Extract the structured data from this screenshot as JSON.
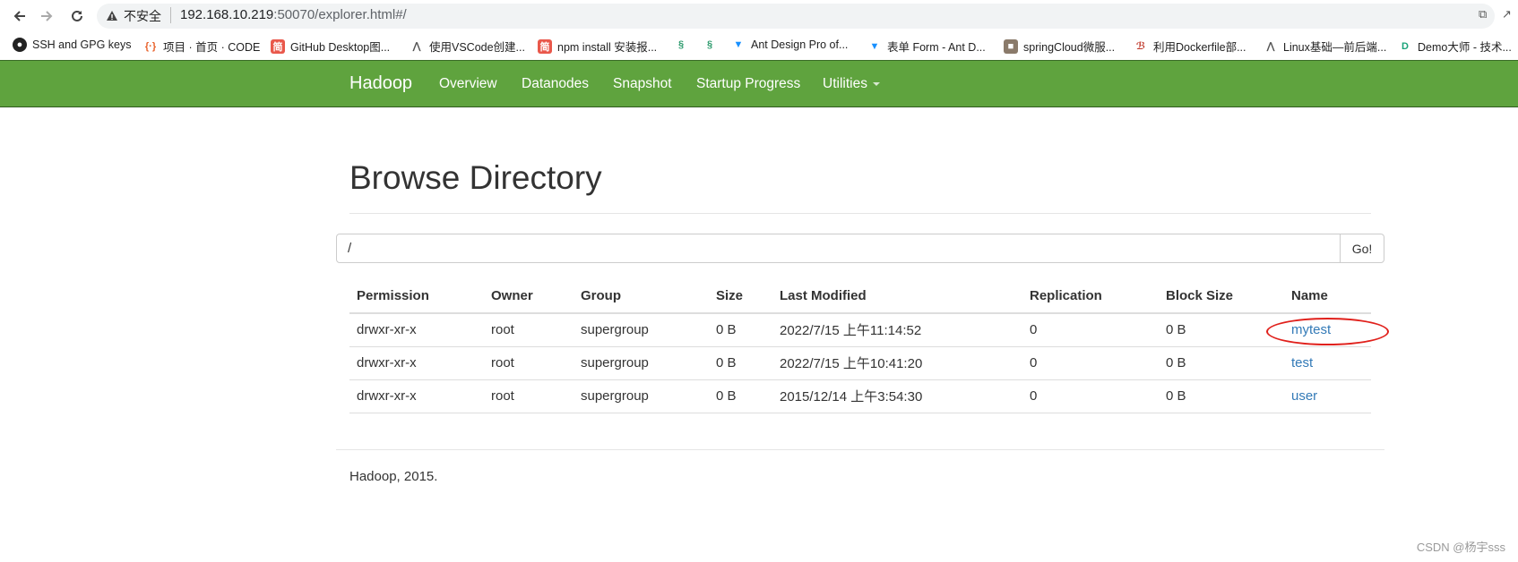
{
  "browser": {
    "url_warning": "不安全",
    "url_host": "192.168.10.219",
    "url_path": ":50070/explorer.html#/",
    "bookmarks": [
      {
        "label": "SSH and GPG keys",
        "icon": "github-icon"
      },
      {
        "label": "项目 · 首页 · CODE",
        "icon": "code-icon"
      },
      {
        "label": "GitHub Desktop图...",
        "icon": "jianshu-icon"
      },
      {
        "label": "使用VSCode创建...",
        "icon": "juejin-icon"
      },
      {
        "label": "npm install 安装报...",
        "icon": "jianshu-icon"
      },
      {
        "label": "",
        "icon": "swirl-icon"
      },
      {
        "label": "",
        "icon": "swirl-icon"
      },
      {
        "label": "Ant Design Pro of...",
        "icon": "antd-icon"
      },
      {
        "label": "表单 Form - Ant D...",
        "icon": "antd-icon"
      },
      {
        "label": "springCloud微服...",
        "icon": "avatar-icon"
      },
      {
        "label": "利用Dockerfile部...",
        "icon": "b-icon"
      },
      {
        "label": "Linux基础—前后端...",
        "icon": "juejin-icon"
      },
      {
        "label": "Demo大师 - 技术...",
        "icon": "demo-icon"
      }
    ]
  },
  "navbar": {
    "brand": "Hadoop",
    "items": [
      "Overview",
      "Datanodes",
      "Snapshot",
      "Startup Progress",
      "Utilities"
    ]
  },
  "main": {
    "title": "Browse Directory",
    "path_value": "/",
    "go_label": "Go!",
    "columns": [
      "Permission",
      "Owner",
      "Group",
      "Size",
      "Last Modified",
      "Replication",
      "Block Size",
      "Name"
    ],
    "rows": [
      {
        "permission": "drwxr-xr-x",
        "owner": "root",
        "group": "supergroup",
        "size": "0 B",
        "modified": "2022/7/15 上午11:14:52",
        "replication": "0",
        "block_size": "0 B",
        "name": "mytest"
      },
      {
        "permission": "drwxr-xr-x",
        "owner": "root",
        "group": "supergroup",
        "size": "0 B",
        "modified": "2022/7/15 上午10:41:20",
        "replication": "0",
        "block_size": "0 B",
        "name": "test"
      },
      {
        "permission": "drwxr-xr-x",
        "owner": "root",
        "group": "supergroup",
        "size": "0 B",
        "modified": "2015/12/14 上午3:54:30",
        "replication": "0",
        "block_size": "0 B",
        "name": "user"
      }
    ]
  },
  "footer": {
    "text": "Hadoop, 2015."
  },
  "watermark": "CSDN @杨宇sss",
  "colors": {
    "navbar": "#5fa33e",
    "link": "#337ab7",
    "highlight": "#e0201b"
  }
}
